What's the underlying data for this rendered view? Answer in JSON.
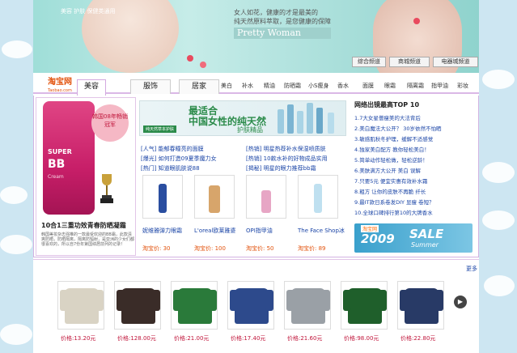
{
  "banner": {
    "tag": "美容 护肤 保健类通用",
    "slogan_line1": "女人如花，健康的才是最美的",
    "slogan_line2": "纯天然原料萃取，是您健康的保障",
    "pretty_woman": "Pretty Woman",
    "channels": [
      "综合频道",
      "商城频道",
      "电器城频道"
    ]
  },
  "nav": {
    "logo": "淘宝网",
    "logo_sub": "Taobao.com",
    "tabs": [
      "美容",
      "服饰",
      "居家"
    ],
    "categories": [
      "美白",
      "补水",
      "精油",
      "防晒霜",
      "小S瘦身",
      "香水",
      "面膜",
      "眼霜",
      "隔离霜",
      "指甲油",
      "彩妆"
    ]
  },
  "left_promo": {
    "badge": "韩国08年畅销冠军",
    "bb_line1": "SUPER",
    "bb_line2": "BB",
    "bb_line3": "Cream",
    "title": "10合1三重功效青春防晒凝霜",
    "desc": "韩国美妆杂志强推的一款最受欢迎的BB霜，此款清爽防晒，防晒隔离，隔离防辐射，是亚洲的少女们都很喜欢的，所以自7份年第国绩居前列的记录！"
  },
  "mid": {
    "promo_big1": "最适合",
    "promo_big2": "中国女性的纯天然",
    "promo_small": "护肤精品",
    "promo_label": "纯天然草本护肤",
    "links_left": [
      "[人气] 能郁春瞳亮的面膜",
      "[爆光] 如何打造09夏季魔力女",
      "[热门] 知道眼肌肤说88"
    ],
    "links_right": [
      "[热销] 明星热荐补水保湿喷质肤",
      "[热销] 10款水补的好物成品实用",
      "[揭秘] 明星的眼力推荐bb霜"
    ],
    "thumbs": [
      {
        "name": "妮维雅弹力眼霜",
        "price": "淘宝价: 30"
      },
      {
        "name": "L'oreal欧莱雅婆",
        "price": "淘宝价: 100"
      },
      {
        "name": "OPI指甲油",
        "price": "淘宝价: 50"
      },
      {
        "name": "The Face Shop冰",
        "price": "淘宝价: 89"
      }
    ]
  },
  "right": {
    "title": "网络出镜最高TOP 10",
    "items": [
      "1.7大女星僧瘦美的大法背后",
      "2.美白魔法大公开？ 30岁依然不怕晒",
      "3.敏感肌秋冬护理，缓解不适感觉",
      "4.独家美白配方 教你轻松美白！",
      "5.简单动作轻松做，轻松逆龄！",
      "6.美肤满方大公开 美白 误解",
      "7.只要5元 便宜实惠有效补水霜",
      "8.粗方 让你的皮肤不再脆 纤长",
      "9.最IT款日系卷发DIY 显瘦 卷短？",
      "10.全球口碑排行第10的大牌香水"
    ],
    "sale_tb": "淘宝网",
    "sale_year": "2009",
    "sale_word": "SALE",
    "sale_summer": "Summer"
  },
  "bottom": {
    "more": "更多",
    "products": [
      {
        "price": "价格:13.20元",
        "color": "#d9d3c4"
      },
      {
        "price": "价格:128.00元",
        "color": "#3a2c28"
      },
      {
        "price": "价格:21.00元",
        "color": "#2a7a3a"
      },
      {
        "price": "价格:17.40元",
        "color": "#2d4a8c"
      },
      {
        "price": "价格:21.60元",
        "color": "#9aa0a6"
      },
      {
        "price": "价格:98.00元",
        "color": "#1f5f2b"
      },
      {
        "price": "价格:22.80元",
        "color": "#283a66"
      }
    ]
  }
}
